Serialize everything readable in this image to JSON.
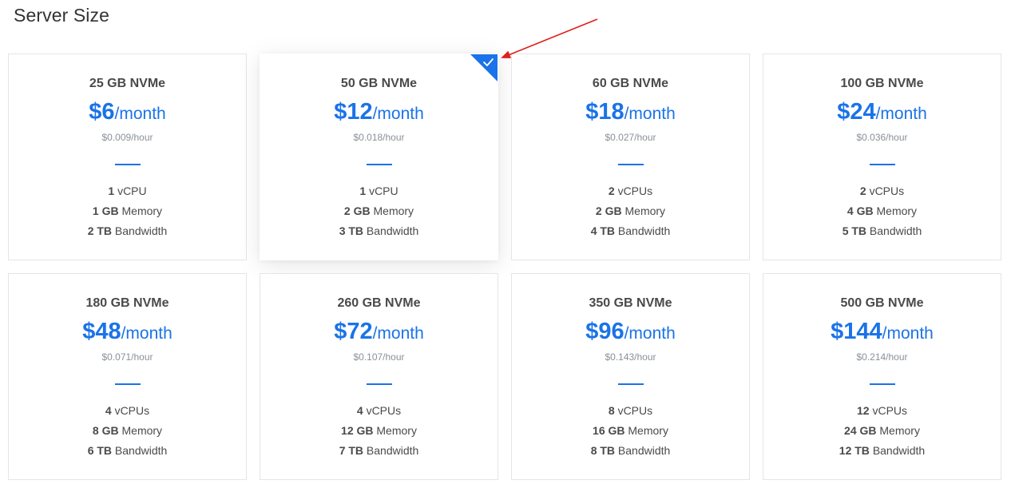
{
  "page": {
    "title": "Server Size"
  },
  "colors": {
    "accent": "#1a73e8",
    "annotation": "#e0201b",
    "border": "#e3e5e8"
  },
  "selected_index": 1,
  "plans": [
    {
      "disk": "25 GB NVMe",
      "price": "$6",
      "per": "/month",
      "hourly": "$0.009/hour",
      "cpu_value": "1",
      "cpu_unit": "vCPU",
      "mem_value": "1 GB",
      "mem_unit": "Memory",
      "bw_value": "2 TB",
      "bw_unit": "Bandwidth"
    },
    {
      "disk": "50 GB NVMe",
      "price": "$12",
      "per": "/month",
      "hourly": "$0.018/hour",
      "cpu_value": "1",
      "cpu_unit": "vCPU",
      "mem_value": "2 GB",
      "mem_unit": "Memory",
      "bw_value": "3 TB",
      "bw_unit": "Bandwidth"
    },
    {
      "disk": "60 GB NVMe",
      "price": "$18",
      "per": "/month",
      "hourly": "$0.027/hour",
      "cpu_value": "2",
      "cpu_unit": "vCPUs",
      "mem_value": "2 GB",
      "mem_unit": "Memory",
      "bw_value": "4 TB",
      "bw_unit": "Bandwidth"
    },
    {
      "disk": "100 GB NVMe",
      "price": "$24",
      "per": "/month",
      "hourly": "$0.036/hour",
      "cpu_value": "2",
      "cpu_unit": "vCPUs",
      "mem_value": "4 GB",
      "mem_unit": "Memory",
      "bw_value": "5 TB",
      "bw_unit": "Bandwidth"
    },
    {
      "disk": "180 GB NVMe",
      "price": "$48",
      "per": "/month",
      "hourly": "$0.071/hour",
      "cpu_value": "4",
      "cpu_unit": "vCPUs",
      "mem_value": "8 GB",
      "mem_unit": "Memory",
      "bw_value": "6 TB",
      "bw_unit": "Bandwidth"
    },
    {
      "disk": "260 GB NVMe",
      "price": "$72",
      "per": "/month",
      "hourly": "$0.107/hour",
      "cpu_value": "4",
      "cpu_unit": "vCPUs",
      "mem_value": "12 GB",
      "mem_unit": "Memory",
      "bw_value": "7 TB",
      "bw_unit": "Bandwidth"
    },
    {
      "disk": "350 GB NVMe",
      "price": "$96",
      "per": "/month",
      "hourly": "$0.143/hour",
      "cpu_value": "8",
      "cpu_unit": "vCPUs",
      "mem_value": "16 GB",
      "mem_unit": "Memory",
      "bw_value": "8 TB",
      "bw_unit": "Bandwidth"
    },
    {
      "disk": "500 GB NVMe",
      "price": "$144",
      "per": "/month",
      "hourly": "$0.214/hour",
      "cpu_value": "12",
      "cpu_unit": "vCPUs",
      "mem_value": "24 GB",
      "mem_unit": "Memory",
      "bw_value": "12 TB",
      "bw_unit": "Bandwidth"
    }
  ]
}
